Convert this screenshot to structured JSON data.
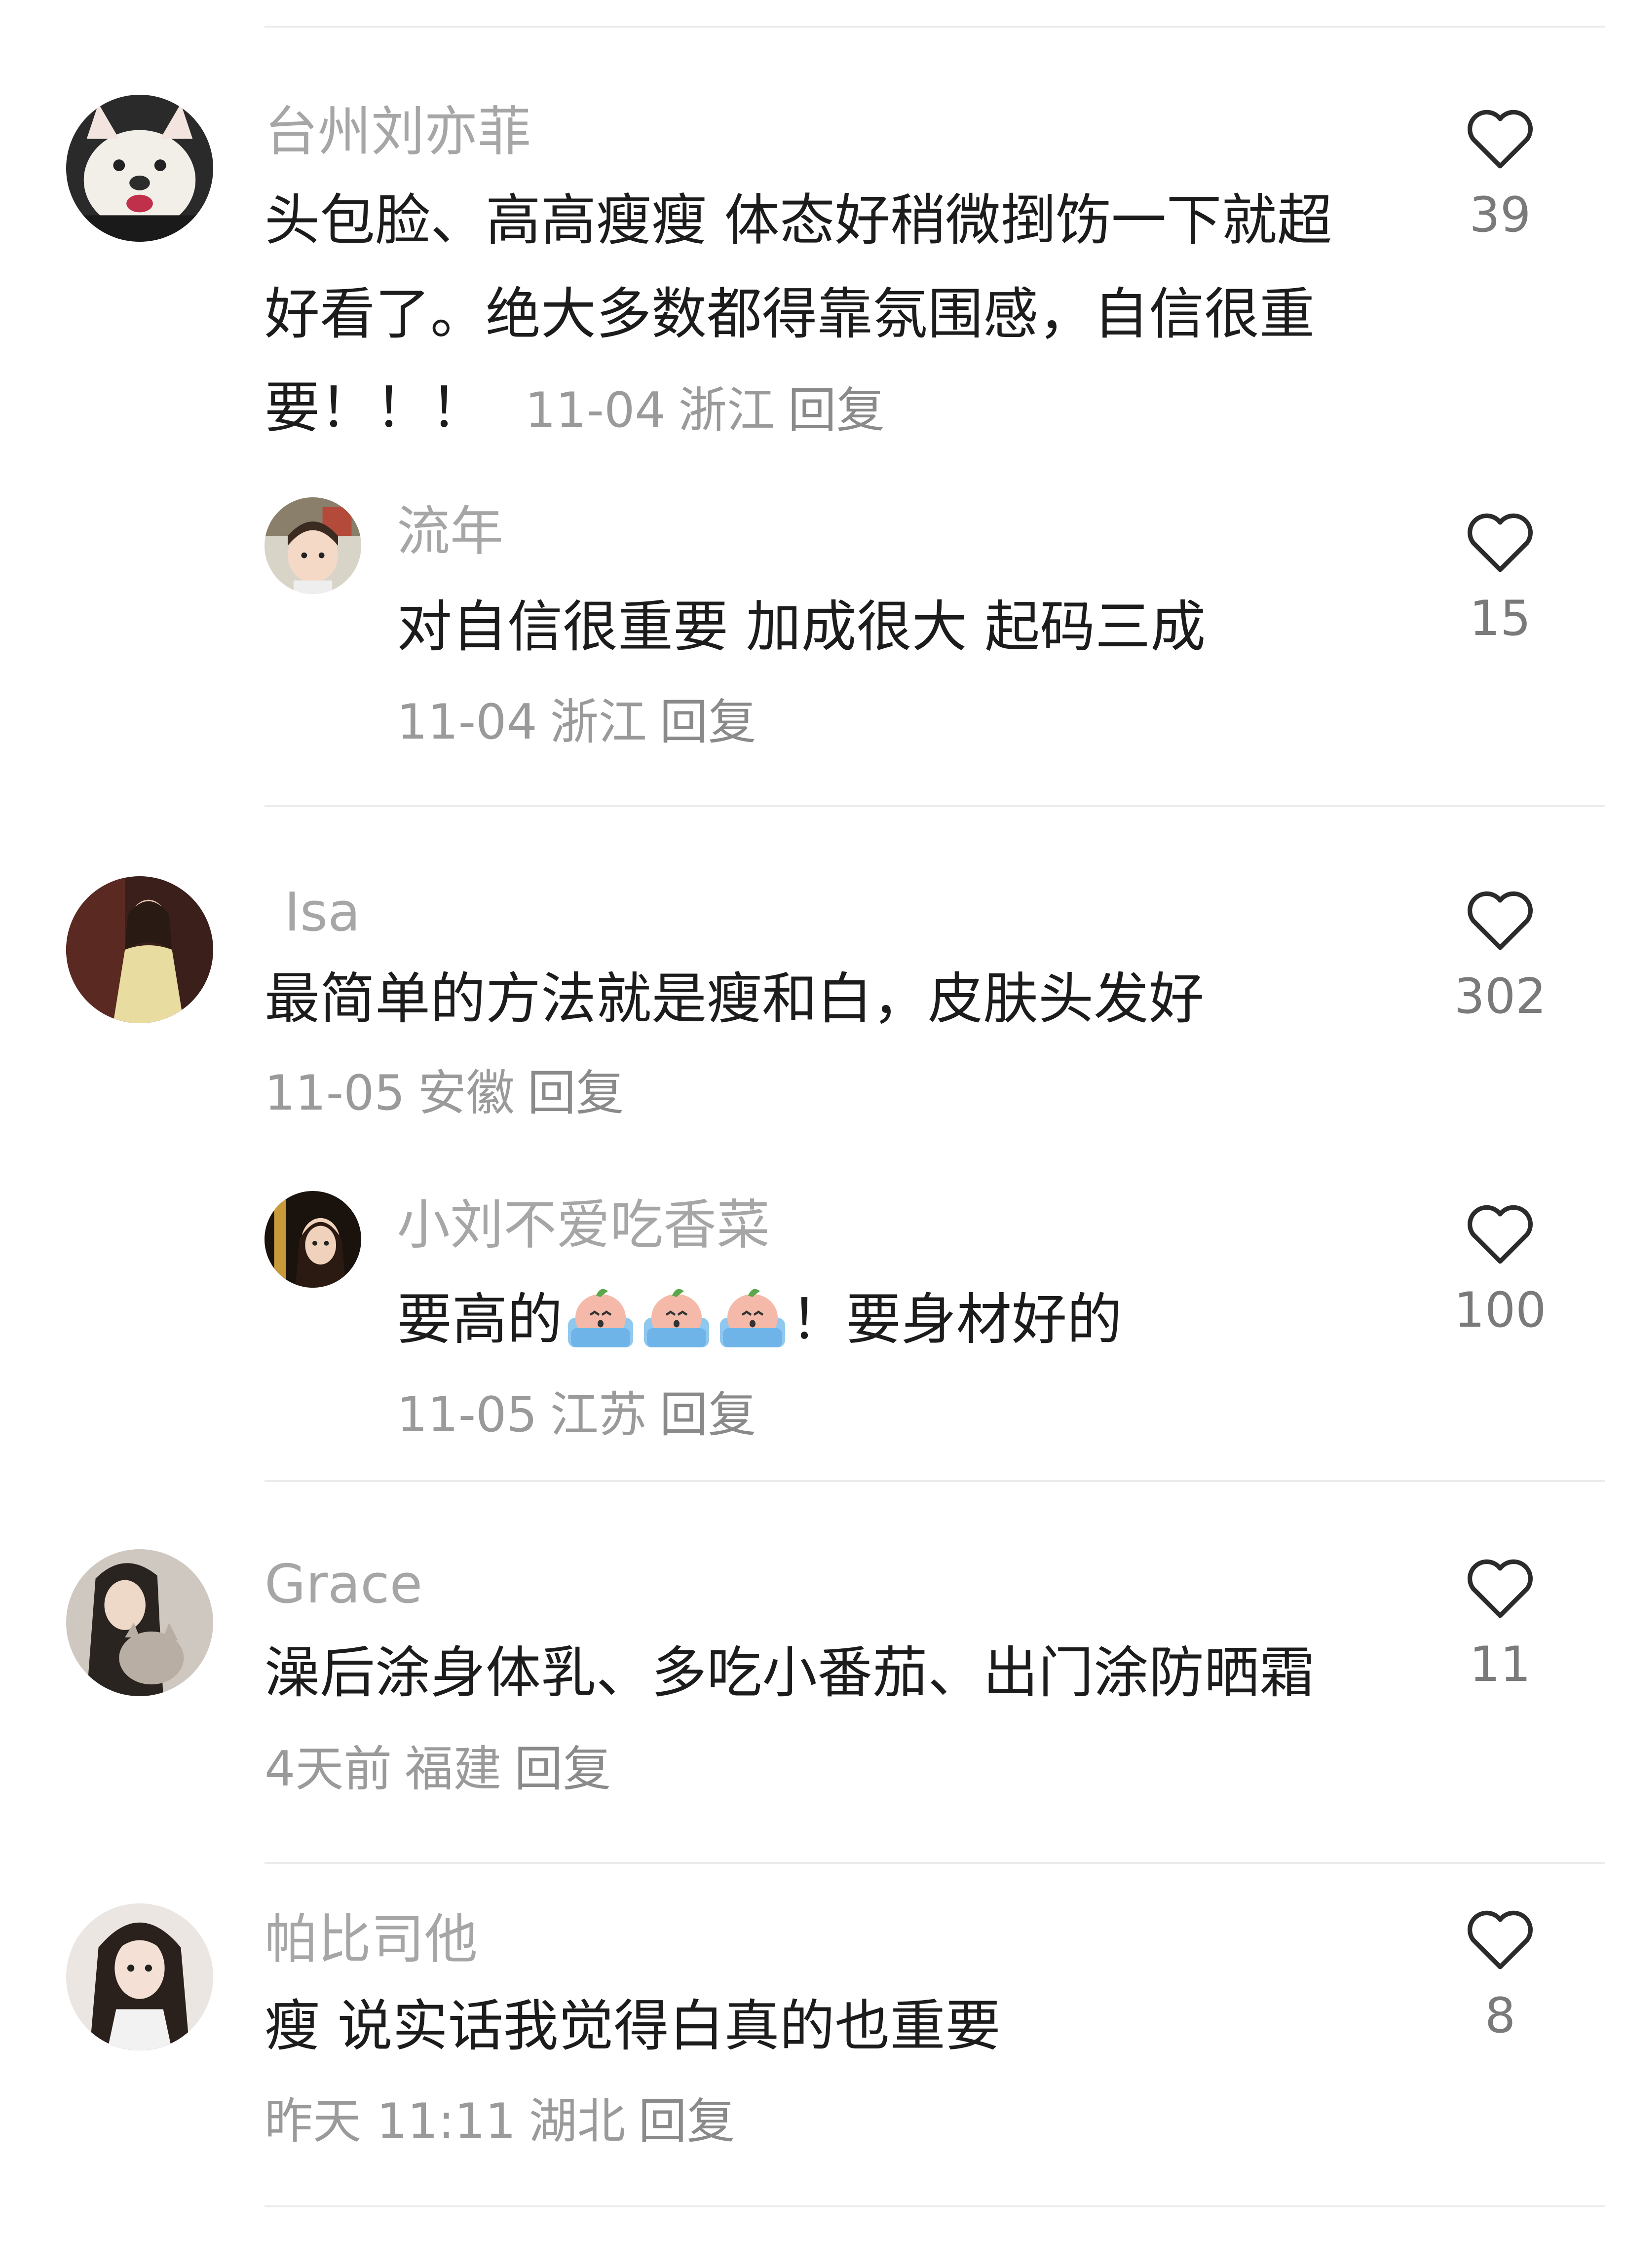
{
  "comments": [
    {
      "username": "台州刘亦菲",
      "text": "头包脸、高高瘦瘦  体态好稍微捯饬一下就超好看了。绝大多数都得靠氛围感，自信很重要！！！",
      "date": "11-04",
      "location": "浙江",
      "reply_label": "回复",
      "likes": "39",
      "avatar": "bulldog-avatar",
      "replies": [
        {
          "username": "流年",
          "text": "对自信很重要 加成很大 起码三成",
          "date": "11-04",
          "location": "浙江",
          "reply_label": "回复",
          "likes": "15",
          "avatar": "child-avatar"
        }
      ]
    },
    {
      "username": "Isa",
      "text": "最简单的方法就是瘦和白，皮肤头发好",
      "date": "11-05",
      "location": "安徽",
      "reply_label": "回复",
      "likes": "302",
      "avatar": "woman-dress-avatar",
      "replies": [
        {
          "username": "小刘不爱吃香菜",
          "text_before": "要高的",
          "emojis": [
            "crying-peach-emoji",
            "crying-peach-emoji",
            "crying-peach-emoji"
          ],
          "text_after": "！要身材好的",
          "date": "11-05",
          "location": "江苏",
          "reply_label": "回复",
          "likes": "100",
          "avatar": "girl-dark-avatar"
        }
      ]
    },
    {
      "username": "Grace",
      "text": "澡后涂身体乳、多吃小番茄、出门涂防晒霜",
      "date": "4天前",
      "location": "福建",
      "reply_label": "回复",
      "likes": "11",
      "avatar": "girl-with-cat-avatar",
      "replies": []
    },
    {
      "username": "帕比司他",
      "text": "瘦 说实话我觉得白真的也重要",
      "date": "昨天 11:11",
      "location": "湖北",
      "reply_label": "回复",
      "likes": "8",
      "avatar": "long-hair-girl-avatar",
      "replies": []
    }
  ],
  "colors": {
    "username": "#a6a6a6",
    "text": "#1c1c1c",
    "meta": "#9a9a9a",
    "heart_stroke": "#2b2b2b",
    "divider": "#ececec"
  }
}
